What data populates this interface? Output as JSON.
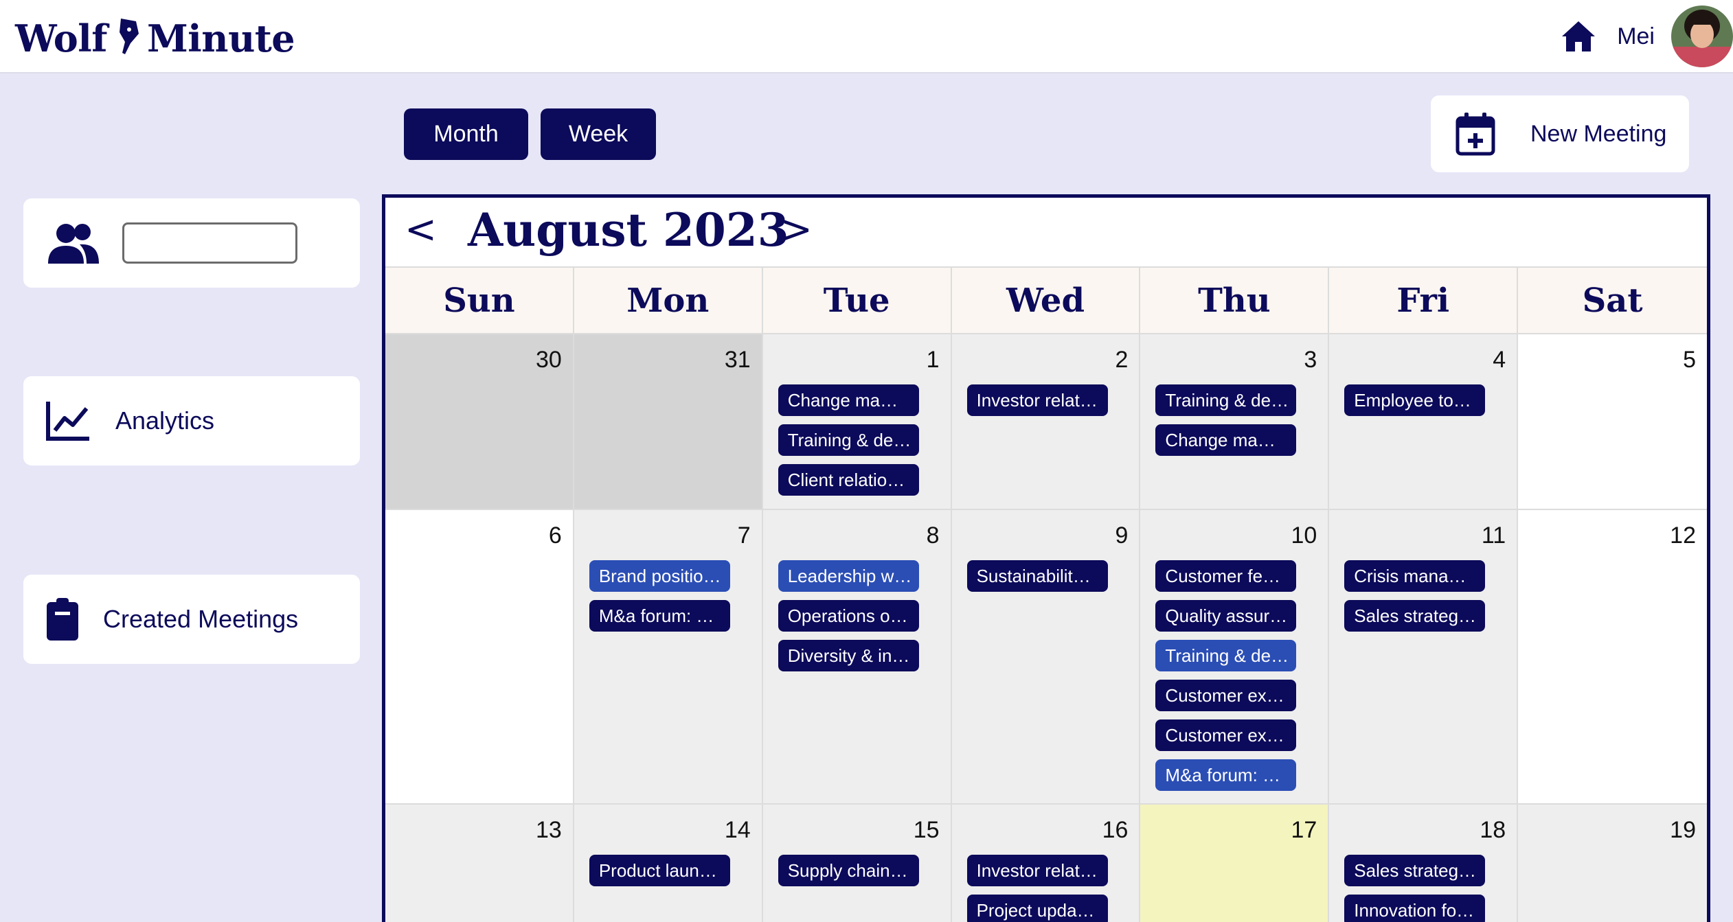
{
  "app": {
    "logo_left": "Wolf",
    "logo_right": "Minute"
  },
  "header": {
    "user_name": "Mei"
  },
  "view_toggle": {
    "month_label": "Month",
    "week_label": "Week"
  },
  "new_meeting": {
    "label": "New Meeting"
  },
  "sidebar": {
    "search_value": "",
    "analytics_label": "Analytics",
    "created_meetings_label": "Created Meetings"
  },
  "calendar": {
    "prev": "<",
    "next": ">",
    "title": "August 2023",
    "days_of_week": [
      "Sun",
      "Mon",
      "Tue",
      "Wed",
      "Thu",
      "Fri",
      "Sat"
    ],
    "weeks": [
      [
        {
          "num": "30",
          "state": "off",
          "events": []
        },
        {
          "num": "31",
          "state": "off",
          "events": []
        },
        {
          "num": "1",
          "state": "busy",
          "events": [
            {
              "t": "Change ma…"
            },
            {
              "t": "Training & de…"
            },
            {
              "t": "Client relatio…"
            }
          ]
        },
        {
          "num": "2",
          "state": "busy",
          "events": [
            {
              "t": "Investor relat…"
            }
          ]
        },
        {
          "num": "3",
          "state": "busy",
          "events": [
            {
              "t": "Training & de…"
            },
            {
              "t": "Change ma…"
            }
          ]
        },
        {
          "num": "4",
          "state": "busy",
          "events": [
            {
              "t": "Employee to…"
            }
          ]
        },
        {
          "num": "5",
          "state": "plain",
          "events": []
        }
      ],
      [
        {
          "num": "6",
          "state": "plain",
          "events": []
        },
        {
          "num": "7",
          "state": "busy",
          "events": [
            {
              "t": "Brand positio…",
              "style": "light"
            },
            {
              "t": "M&a forum: …"
            }
          ]
        },
        {
          "num": "8",
          "state": "busy",
          "events": [
            {
              "t": "Leadership w…",
              "style": "light"
            },
            {
              "t": "Operations o…"
            },
            {
              "t": "Diversity & in…"
            }
          ]
        },
        {
          "num": "9",
          "state": "busy",
          "events": [
            {
              "t": "Sustainabilit…"
            }
          ]
        },
        {
          "num": "10",
          "state": "busy",
          "events": [
            {
              "t": "Customer fe…"
            },
            {
              "t": "Quality assur…"
            },
            {
              "t": "Training & de…",
              "style": "light"
            },
            {
              "t": "Customer ex…"
            },
            {
              "t": "Customer ex…"
            },
            {
              "t": "M&a forum: …",
              "style": "light"
            }
          ]
        },
        {
          "num": "11",
          "state": "busy",
          "events": [
            {
              "t": "Crisis mana…"
            },
            {
              "t": "Sales strateg…"
            }
          ]
        },
        {
          "num": "12",
          "state": "plain",
          "events": []
        }
      ],
      [
        {
          "num": "13",
          "state": "busy",
          "events": []
        },
        {
          "num": "14",
          "state": "busy",
          "events": [
            {
              "t": "Product laun…"
            }
          ]
        },
        {
          "num": "15",
          "state": "busy",
          "events": [
            {
              "t": "Supply chain…"
            }
          ]
        },
        {
          "num": "16",
          "state": "busy",
          "events": [
            {
              "t": "Investor relat…"
            },
            {
              "t": "Project upda…"
            }
          ]
        },
        {
          "num": "17",
          "state": "today",
          "events": []
        },
        {
          "num": "18",
          "state": "busy",
          "events": [
            {
              "t": "Sales strateg…"
            },
            {
              "t": "Innovation fo…"
            }
          ]
        },
        {
          "num": "19",
          "state": "busy",
          "events": []
        }
      ]
    ]
  },
  "colors": {
    "primary": "#0c0a5a",
    "event_light": "#2b4eb5",
    "page_bg": "#e6e6f7",
    "today": "#f4f4be"
  }
}
